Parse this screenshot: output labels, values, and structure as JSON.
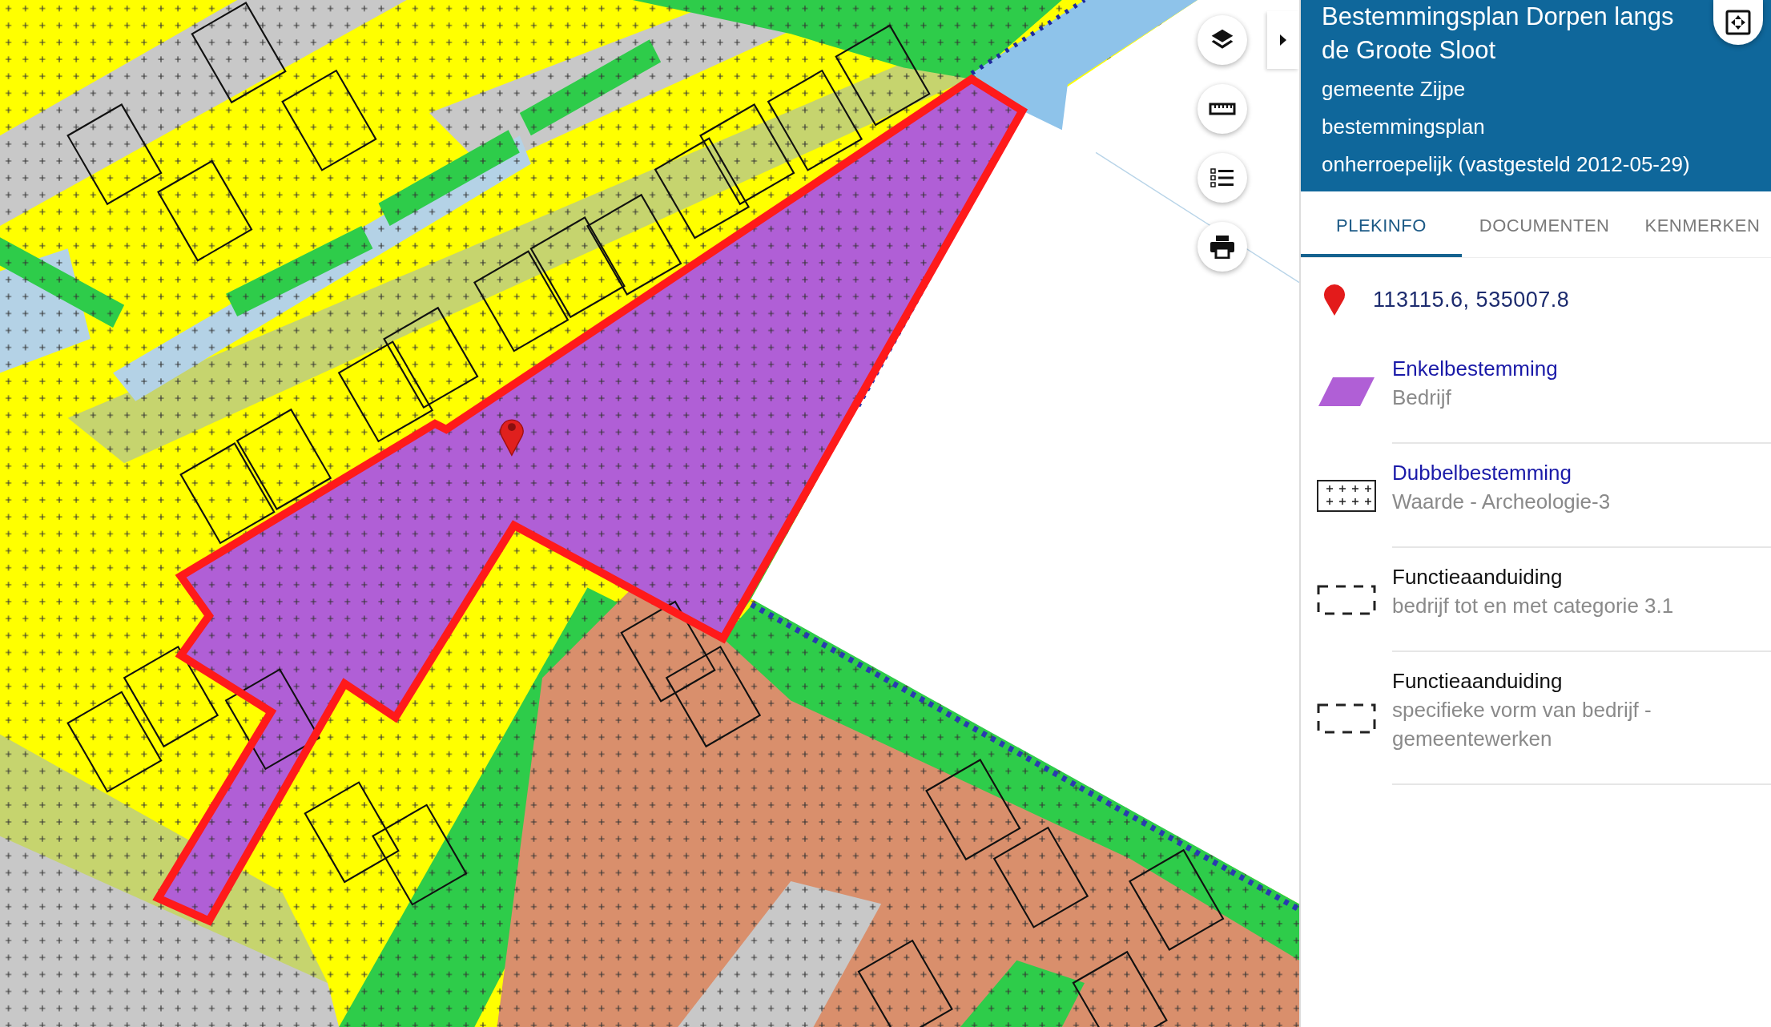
{
  "header": {
    "title": "Bestemmingsplan Dorpen langs de Groote Sloot",
    "lines": [
      "gemeente Zijpe",
      "bestemmingsplan",
      "onherroepelijk (vastgesteld 2012-05-29)"
    ]
  },
  "tabs": [
    {
      "label": "PLEKINFO",
      "selected": true
    },
    {
      "label": "DOCUMENTEN",
      "selected": false
    },
    {
      "label": "KENMERKEN",
      "selected": false
    }
  ],
  "location": {
    "coordinates": "113115.6, 535007.8"
  },
  "legend": [
    {
      "kind": "fill",
      "title": "Enkelbestemming",
      "link": true,
      "detail": "Bedrijf"
    },
    {
      "kind": "hatch",
      "title": "Dubbelbestemming",
      "link": true,
      "detail": "Waarde - Archeologie-3"
    },
    {
      "kind": "dashed",
      "title": "Functieaanduiding",
      "link": false,
      "detail": "bedrijf tot en met categorie 3.1"
    },
    {
      "kind": "dashed",
      "title": "Functieaanduiding",
      "link": false,
      "detail": "specifieke vorm van bedrijf - gemeentewerken"
    }
  ]
}
